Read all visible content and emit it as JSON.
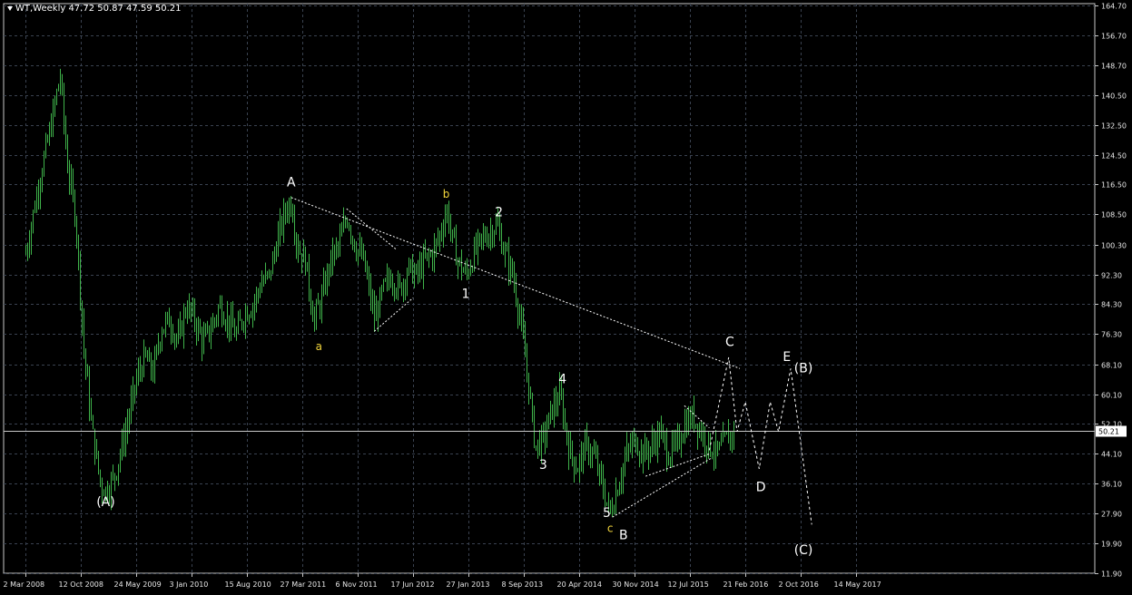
{
  "header": {
    "symbol_line": "WT,Weekly  47.72 50.87 47.59 50.21"
  },
  "colors": {
    "background": "#000000",
    "grid": "#3a4250",
    "axis": "#c8c8c8",
    "bars": "#3fb34a",
    "wave_white": "#ffffff",
    "wave_yellow": "#f2d53c",
    "price_line": "#c8c8c8"
  },
  "chart_data": {
    "type": "bar",
    "title": "",
    "series": [
      {
        "name": "WT",
        "timeframe": "Weekly"
      }
    ],
    "current_price": 50.21,
    "price_ticks": [
      164.7,
      156.7,
      148.7,
      140.5,
      132.5,
      124.5,
      116.5,
      108.5,
      100.3,
      92.3,
      84.3,
      76.3,
      68.1,
      60.1,
      52.1,
      44.1,
      36.1,
      27.9,
      19.9,
      11.9
    ],
    "time_labels": [
      "2 Mar 2008",
      "12 Oct 2008",
      "24 May 2009",
      "3 Jan 2010",
      "15 Aug 2010",
      "27 Mar 2011",
      "6 Nov 2011",
      "17 Jun 2012",
      "27 Jan 2013",
      "8 Sep 2013",
      "20 Apr 2014",
      "30 Nov 2014",
      "12 Jul 2015",
      "21 Feb 2016",
      "2 Oct 2016",
      "14 May 2017"
    ],
    "ylim": [
      11.9,
      164.7
    ],
    "price_path": [
      {
        "t": 0.0,
        "p": 98
      },
      {
        "t": 0.25,
        "p": 118
      },
      {
        "t": 0.45,
        "p": 132
      },
      {
        "t": 0.62,
        "p": 146
      },
      {
        "t": 0.75,
        "p": 122
      },
      {
        "t": 0.9,
        "p": 108
      },
      {
        "t": 1.05,
        "p": 72
      },
      {
        "t": 1.2,
        "p": 50
      },
      {
        "t": 1.35,
        "p": 36
      },
      {
        "t": 1.45,
        "p": 34
      },
      {
        "t": 1.6,
        "p": 38
      },
      {
        "t": 1.8,
        "p": 50
      },
      {
        "t": 2.0,
        "p": 64
      },
      {
        "t": 2.15,
        "p": 70
      },
      {
        "t": 2.3,
        "p": 66
      },
      {
        "t": 2.45,
        "p": 78
      },
      {
        "t": 2.6,
        "p": 80
      },
      {
        "t": 2.75,
        "p": 74
      },
      {
        "t": 2.9,
        "p": 84
      },
      {
        "t": 3.05,
        "p": 80
      },
      {
        "t": 3.2,
        "p": 74
      },
      {
        "t": 3.35,
        "p": 78
      },
      {
        "t": 3.5,
        "p": 84
      },
      {
        "t": 3.65,
        "p": 80
      },
      {
        "t": 3.8,
        "p": 76
      },
      {
        "t": 3.95,
        "p": 82
      },
      {
        "t": 4.1,
        "p": 84
      },
      {
        "t": 4.25,
        "p": 90
      },
      {
        "t": 4.4,
        "p": 92
      },
      {
        "t": 4.55,
        "p": 102
      },
      {
        "t": 4.7,
        "p": 110
      },
      {
        "t": 4.8,
        "p": 112
      },
      {
        "t": 4.9,
        "p": 100
      },
      {
        "t": 5.05,
        "p": 96
      },
      {
        "t": 5.2,
        "p": 80
      },
      {
        "t": 5.35,
        "p": 86
      },
      {
        "t": 5.5,
        "p": 96
      },
      {
        "t": 5.65,
        "p": 100
      },
      {
        "t": 5.8,
        "p": 108
      },
      {
        "t": 5.95,
        "p": 100
      },
      {
        "t": 6.1,
        "p": 96
      },
      {
        "t": 6.2,
        "p": 88
      },
      {
        "t": 6.3,
        "p": 80
      },
      {
        "t": 6.45,
        "p": 88
      },
      {
        "t": 6.6,
        "p": 92
      },
      {
        "t": 6.75,
        "p": 88
      },
      {
        "t": 6.9,
        "p": 94
      },
      {
        "t": 7.05,
        "p": 92
      },
      {
        "t": 7.2,
        "p": 96
      },
      {
        "t": 7.35,
        "p": 98
      },
      {
        "t": 7.5,
        "p": 104
      },
      {
        "t": 7.6,
        "p": 110
      },
      {
        "t": 7.7,
        "p": 102
      },
      {
        "t": 7.8,
        "p": 96
      },
      {
        "t": 7.95,
        "p": 92
      },
      {
        "t": 8.1,
        "p": 98
      },
      {
        "t": 8.25,
        "p": 102
      },
      {
        "t": 8.4,
        "p": 104
      },
      {
        "t": 8.5,
        "p": 106
      },
      {
        "t": 8.65,
        "p": 98
      },
      {
        "t": 8.8,
        "p": 92
      },
      {
        "t": 8.95,
        "p": 78
      },
      {
        "t": 9.1,
        "p": 60
      },
      {
        "t": 9.2,
        "p": 46
      },
      {
        "t": 9.35,
        "p": 48
      },
      {
        "t": 9.5,
        "p": 56
      },
      {
        "t": 9.65,
        "p": 60
      },
      {
        "t": 9.8,
        "p": 46
      },
      {
        "t": 9.95,
        "p": 40
      },
      {
        "t": 10.1,
        "p": 46
      },
      {
        "t": 10.25,
        "p": 44
      },
      {
        "t": 10.4,
        "p": 36
      },
      {
        "t": 10.55,
        "p": 28
      },
      {
        "t": 10.7,
        "p": 36
      },
      {
        "t": 10.85,
        "p": 44
      },
      {
        "t": 11.0,
        "p": 48
      },
      {
        "t": 11.15,
        "p": 44
      },
      {
        "t": 11.3,
        "p": 46
      },
      {
        "t": 11.45,
        "p": 50
      },
      {
        "t": 11.6,
        "p": 44
      },
      {
        "t": 11.75,
        "p": 46
      },
      {
        "t": 11.9,
        "p": 52
      },
      {
        "t": 12.05,
        "p": 54
      },
      {
        "t": 12.2,
        "p": 50
      },
      {
        "t": 12.35,
        "p": 46
      },
      {
        "t": 12.5,
        "p": 44
      },
      {
        "t": 12.65,
        "p": 48
      },
      {
        "t": 12.8,
        "p": 50
      }
    ],
    "trendlines": [
      {
        "style": "dotted",
        "points": [
          {
            "t": 4.8,
            "p": 113
          },
          {
            "t": 12.9,
            "p": 67
          }
        ]
      },
      {
        "style": "dotted",
        "points": [
          {
            "t": 5.8,
            "p": 110
          },
          {
            "t": 6.7,
            "p": 99
          }
        ]
      },
      {
        "style": "dotted",
        "points": [
          {
            "t": 6.3,
            "p": 77
          },
          {
            "t": 7.0,
            "p": 86
          }
        ]
      },
      {
        "style": "dotted",
        "points": [
          {
            "t": 10.6,
            "p": 27
          },
          {
            "t": 12.4,
            "p": 43
          }
        ]
      },
      {
        "style": "dotted",
        "points": [
          {
            "t": 11.2,
            "p": 38
          },
          {
            "t": 12.35,
            "p": 44
          }
        ]
      },
      {
        "style": "dotted",
        "points": [
          {
            "t": 11.9,
            "p": 57
          },
          {
            "t": 12.35,
            "p": 51
          }
        ]
      }
    ],
    "projection": [
      {
        "t": 12.35,
        "p": 45
      },
      {
        "t": 12.7,
        "p": 70
      },
      {
        "t": 12.85,
        "p": 50
      },
      {
        "t": 13.0,
        "p": 58
      },
      {
        "t": 13.25,
        "p": 40
      },
      {
        "t": 13.45,
        "p": 58
      },
      {
        "t": 13.6,
        "p": 50
      },
      {
        "t": 13.82,
        "p": 67
      },
      {
        "t": 14.2,
        "p": 25
      }
    ],
    "wave_labels": [
      {
        "text": "(A)",
        "t": 1.45,
        "p": 30,
        "color": "white"
      },
      {
        "text": "A",
        "t": 4.8,
        "p": 116,
        "color": "white"
      },
      {
        "text": "a",
        "t": 5.3,
        "p": 72,
        "color": "yellow"
      },
      {
        "text": "b",
        "t": 7.6,
        "p": 113,
        "color": "yellow"
      },
      {
        "text": "1",
        "t": 7.95,
        "p": 86,
        "color": "white"
      },
      {
        "text": "2",
        "t": 8.55,
        "p": 108,
        "color": "white"
      },
      {
        "text": "3",
        "t": 9.35,
        "p": 40,
        "color": "white"
      },
      {
        "text": "4",
        "t": 9.7,
        "p": 63,
        "color": "white"
      },
      {
        "text": "5",
        "t": 10.5,
        "p": 27,
        "color": "white"
      },
      {
        "text": "c",
        "t": 10.56,
        "p": 23,
        "color": "yellow"
      },
      {
        "text": "B",
        "t": 10.8,
        "p": 21,
        "color": "white"
      },
      {
        "text": "C",
        "t": 12.72,
        "p": 73,
        "color": "white"
      },
      {
        "text": "D",
        "t": 13.28,
        "p": 34,
        "color": "white"
      },
      {
        "text": "E",
        "t": 13.75,
        "p": 69,
        "color": "white"
      },
      {
        "text": "(B)",
        "t": 14.05,
        "p": 66,
        "color": "white"
      },
      {
        "text": "(C)",
        "t": 14.05,
        "p": 17,
        "color": "white"
      }
    ]
  }
}
